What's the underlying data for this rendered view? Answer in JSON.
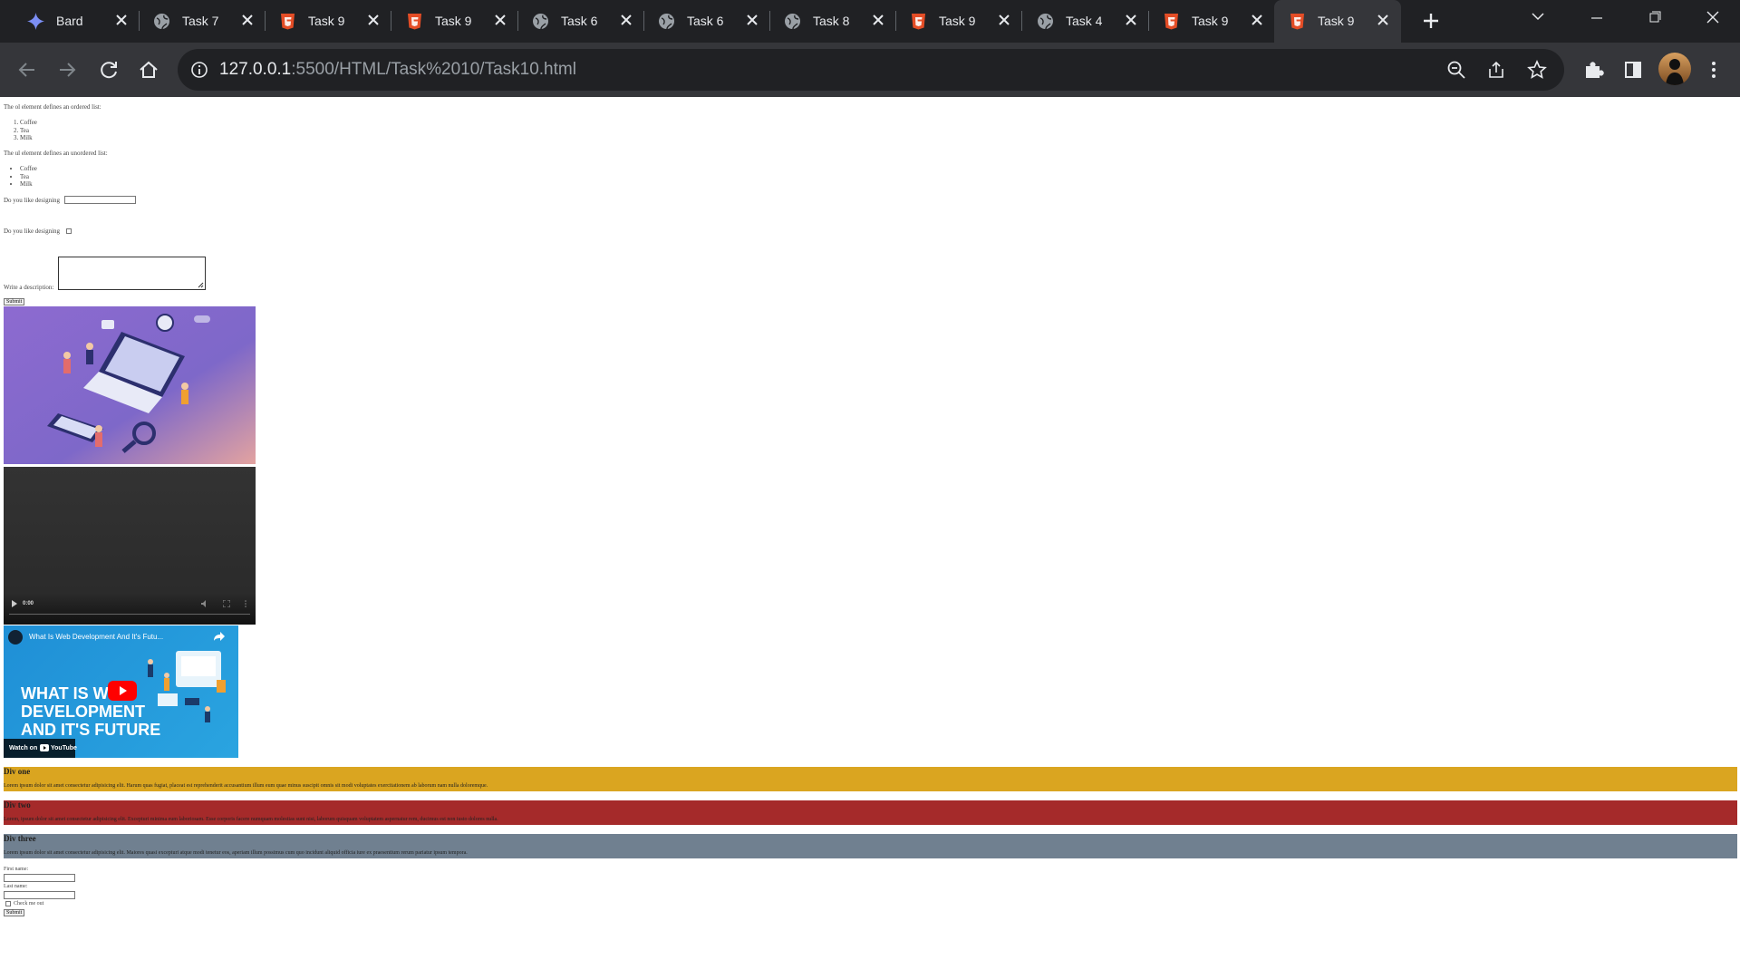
{
  "browser": {
    "tabs": [
      {
        "title": "Bard",
        "favicon": "bard-sparkle-icon"
      },
      {
        "title": "Task 7",
        "favicon": "globe-icon"
      },
      {
        "title": "Task 9",
        "favicon": "html5-icon"
      },
      {
        "title": "Task 9",
        "favicon": "html5-icon"
      },
      {
        "title": "Task 6",
        "favicon": "globe-icon"
      },
      {
        "title": "Task 6",
        "favicon": "globe-icon"
      },
      {
        "title": "Task 8",
        "favicon": "globe-icon"
      },
      {
        "title": "Task 9",
        "favicon": "html5-icon"
      },
      {
        "title": "Task 4",
        "favicon": "globe-icon"
      },
      {
        "title": "Task 9",
        "favicon": "html5-icon"
      },
      {
        "title": "Task 9",
        "favicon": "html5-icon",
        "active": true
      }
    ],
    "address": {
      "host": "127.0.0.1",
      "rest": ":5500/HTML/Task%2010/Task10.html"
    },
    "colors": {
      "tabstrip": "#202124",
      "toolbar": "#35363a",
      "omnibox": "#202124"
    }
  },
  "page": {
    "ol_intro": "The ol element defines an ordered list:",
    "ol_items": [
      "Coffee",
      "Tea",
      "Milk"
    ],
    "ul_intro": "The ul element defines an unordered list:",
    "ul_items": [
      "Coffee",
      "Tea",
      "Milk"
    ],
    "q1_label": "Do you like designing",
    "q2_label": "Do you like designing",
    "desc_label": "Write a description:",
    "submit1": "Submit",
    "video": {
      "time": "0:00"
    },
    "youtube": {
      "title": "What Is Web Development And It's Futu...",
      "headline_1": "WHAT IS W",
      "headline_2": "DEVELOPMENT",
      "headline_3": "AND IT'S FUTURE",
      "watch_on": "Watch on",
      "yt_brand": "YouTube"
    },
    "divs": [
      {
        "heading": "Div one",
        "text": "Lorem ipsum dolor sit amet consectetur adipisicing elit. Harum quas fugiat, placeat est reprehenderit accusantium illum eum quae minus suscipit omnis sit modi voluptates exercitationem ab laborum nam nulla doloremque.",
        "color": "#daa520"
      },
      {
        "heading": "Div two",
        "text": "Lorem, ipsum dolor sit amet consectetur adipisicing elit. Excepturi minima eum laboriosam. Esse corporis facere numquam molestias sunt nisi, laborum quisquam voluptatem aspernatur rem, ducimus est non iusto dolores nulla.",
        "color": "#a52a2a"
      },
      {
        "heading": "Div three",
        "text": "Lorem ipsum dolor sit amet consectetur adipisicing elit. Maiores quasi excepturi atque modi tenetur eos, aperiam illum possimus cum quo incidunt aliquid officia iure ex praesentium rerum pariatur ipsum tempora.",
        "color": "#708090"
      }
    ],
    "form": {
      "first_name_label": "First name:",
      "last_name_label": "Last name:",
      "check_label": "Check me out",
      "submit": "Submit"
    }
  }
}
